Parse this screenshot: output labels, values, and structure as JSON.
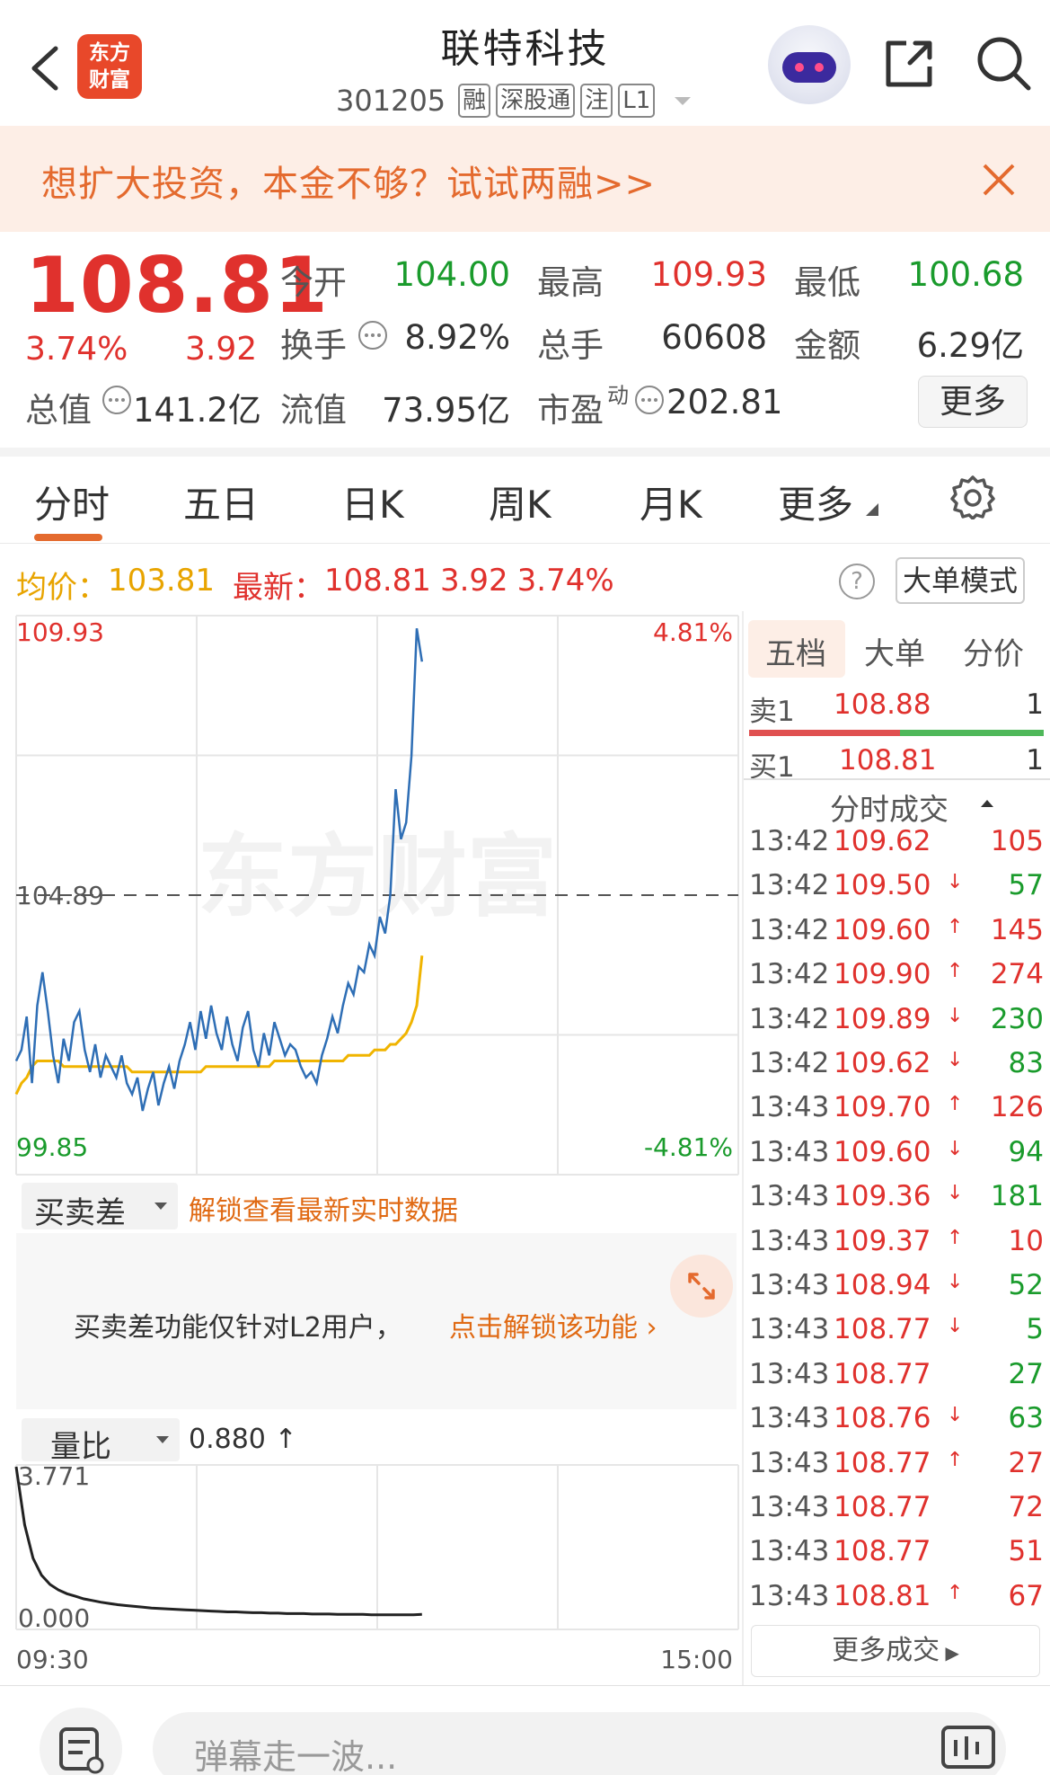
{
  "header": {
    "logo_line1": "东方",
    "logo_line2": "财富",
    "title": "联特科技",
    "code": "301205",
    "tags": [
      "融",
      "深股通",
      "注",
      "L1"
    ]
  },
  "banner": {
    "text": "想扩大投资，本金不够？试试两融>>"
  },
  "quote": {
    "price": "108.81",
    "change_pct": "3.74%",
    "change": "3.92",
    "fields": [
      {
        "label": "今开",
        "value": "104.00",
        "color": "green"
      },
      {
        "label": "最高",
        "value": "109.93",
        "color": "red"
      },
      {
        "label": "最低",
        "value": "100.68",
        "color": "green"
      },
      {
        "label": "换手",
        "value": "8.92%",
        "color": "dark"
      },
      {
        "label": "总手",
        "value": "60608",
        "color": "dark"
      },
      {
        "label": "金额",
        "value": "6.29亿",
        "color": "dark"
      },
      {
        "label": "总值",
        "value": "141.2亿",
        "color": "dark"
      },
      {
        "label": "流值",
        "value": "73.95亿",
        "color": "dark"
      },
      {
        "label": "市盈",
        "value": "202.81",
        "color": "dark"
      }
    ],
    "pe_sup": "动",
    "more_label": "更多"
  },
  "tabs": [
    "分时",
    "五日",
    "日K",
    "周K",
    "月K",
    "更多"
  ],
  "info_line": {
    "avg_label": "均价：",
    "avg_value": "103.81",
    "latest_label": "最新：",
    "latest_value": "108.81",
    "latest_change": "3.92",
    "latest_pct": "3.74%",
    "help": "?",
    "mode_button": "大单模式"
  },
  "chart_data": {
    "type": "line",
    "y_max": 109.93,
    "y_min": 99.85,
    "ref": 104.89,
    "pct_max": "4.81%",
    "pct_min": "-4.81%",
    "watermark": "东方财富",
    "labels": {
      "y_max": "109.93",
      "y_min": "99.85",
      "ref": "104.89"
    },
    "series": [
      {
        "values": [
          101.9,
          102.1,
          102.7,
          101.5,
          102.9,
          103.5,
          102.8,
          102.0,
          101.5,
          102.3,
          101.9,
          102.6,
          102.8,
          102.1,
          101.7,
          102.2,
          101.6,
          102.0,
          101.8,
          101.6,
          102.0,
          101.5,
          101.3,
          101.6,
          101.0,
          101.4,
          101.7,
          101.1,
          101.5,
          101.8,
          101.4,
          101.9,
          102.2,
          102.6,
          102.1,
          102.8,
          102.3,
          102.9,
          102.4,
          102.1,
          102.7,
          102.2,
          101.9,
          102.5,
          102.8,
          102.1,
          101.8,
          102.4,
          102.0,
          102.6,
          102.3,
          102.0,
          102.2,
          102.1,
          101.8,
          101.6,
          101.7,
          101.5,
          102.0,
          102.3,
          102.7,
          102.4,
          102.9,
          103.3,
          103.1,
          103.6,
          103.5,
          104.0,
          103.8,
          104.5,
          104.2,
          104.9,
          106.8,
          105.9,
          106.2,
          107.4,
          109.7,
          109.1
        ],
        "avg_values": [
          101.3,
          101.5,
          101.6,
          101.8,
          101.9,
          101.9,
          101.9,
          101.9,
          101.9,
          101.8,
          101.8,
          101.8,
          101.8,
          101.8,
          101.8,
          101.8,
          101.8,
          101.8,
          101.8,
          101.8,
          101.8,
          101.8,
          101.7,
          101.7,
          101.7,
          101.7,
          101.7,
          101.7,
          101.7,
          101.7,
          101.7,
          101.7,
          101.7,
          101.7,
          101.7,
          101.7,
          101.8,
          101.8,
          101.8,
          101.8,
          101.8,
          101.8,
          101.8,
          101.8,
          101.8,
          101.8,
          101.8,
          101.8,
          101.8,
          101.9,
          101.9,
          101.9,
          101.9,
          101.9,
          101.9,
          101.9,
          101.9,
          101.9,
          101.9,
          101.9,
          101.9,
          101.9,
          101.9,
          102.0,
          102.0,
          102.0,
          102.0,
          102.0,
          102.1,
          102.1,
          102.1,
          102.2,
          102.2,
          102.3,
          102.4,
          102.6,
          102.9,
          103.8
        ]
      }
    ],
    "volume_ratio": {
      "label": "量比",
      "current": "0.880",
      "arrow": "↑",
      "max_label": "3.771",
      "min_label": "0.000",
      "values": [
        3.77,
        2.4,
        1.6,
        1.2,
        0.98,
        0.85,
        0.76,
        0.7,
        0.64,
        0.6,
        0.56,
        0.53,
        0.5,
        0.48,
        0.46,
        0.44,
        0.42,
        0.41,
        0.4,
        0.39,
        0.38,
        0.37,
        0.36,
        0.35,
        0.34,
        0.33,
        0.33,
        0.32,
        0.31,
        0.31,
        0.3,
        0.3,
        0.29,
        0.29,
        0.29,
        0.28,
        0.28,
        0.28,
        0.27,
        0.27,
        0.27,
        0.27,
        0.26,
        0.26,
        0.26,
        0.26,
        0.26,
        0.26,
        0.27
      ]
    },
    "time_start": "09:30",
    "time_end": "15:00"
  },
  "buysell": {
    "selector_label": "买卖差",
    "unlock_link": "解锁查看最新实时数据",
    "message": "买卖差功能仅针对L2用户，",
    "message_link": "点击解锁该功能"
  },
  "right_panel": {
    "tabs": [
      "五档",
      "大单",
      "分价"
    ],
    "sell": {
      "label": "卖1",
      "price": "108.88",
      "volume": "1"
    },
    "buy": {
      "label": "买1",
      "price": "108.81",
      "volume": "1"
    },
    "trades_title": "分时成交",
    "trades": [
      {
        "time": "13:42",
        "price": "109.62",
        "arrow": "",
        "vol": "105",
        "pc": "red",
        "vc": "red"
      },
      {
        "time": "13:42",
        "price": "109.50",
        "arrow": "↓",
        "vol": "57",
        "pc": "red",
        "vc": "green"
      },
      {
        "time": "13:42",
        "price": "109.60",
        "arrow": "↑",
        "vol": "145",
        "pc": "red",
        "vc": "red"
      },
      {
        "time": "13:42",
        "price": "109.90",
        "arrow": "↑",
        "vol": "274",
        "pc": "red",
        "vc": "red"
      },
      {
        "time": "13:42",
        "price": "109.89",
        "arrow": "↓",
        "vol": "230",
        "pc": "red",
        "vc": "green"
      },
      {
        "time": "13:42",
        "price": "109.62",
        "arrow": "↓",
        "vol": "83",
        "pc": "red",
        "vc": "green"
      },
      {
        "time": "13:43",
        "price": "109.70",
        "arrow": "↑",
        "vol": "126",
        "pc": "red",
        "vc": "red"
      },
      {
        "time": "13:43",
        "price": "109.60",
        "arrow": "↓",
        "vol": "94",
        "pc": "red",
        "vc": "green"
      },
      {
        "time": "13:43",
        "price": "109.36",
        "arrow": "↓",
        "vol": "181",
        "pc": "red",
        "vc": "green"
      },
      {
        "time": "13:43",
        "price": "109.37",
        "arrow": "↑",
        "vol": "10",
        "pc": "red",
        "vc": "red"
      },
      {
        "time": "13:43",
        "price": "108.94",
        "arrow": "↓",
        "vol": "52",
        "pc": "red",
        "vc": "green"
      },
      {
        "time": "13:43",
        "price": "108.77",
        "arrow": "↓",
        "vol": "5",
        "pc": "red",
        "vc": "green"
      },
      {
        "time": "13:43",
        "price": "108.77",
        "arrow": "",
        "vol": "27",
        "pc": "red",
        "vc": "green"
      },
      {
        "time": "13:43",
        "price": "108.76",
        "arrow": "↓",
        "vol": "63",
        "pc": "red",
        "vc": "green"
      },
      {
        "time": "13:43",
        "price": "108.77",
        "arrow": "↑",
        "vol": "27",
        "pc": "red",
        "vc": "red"
      },
      {
        "time": "13:43",
        "price": "108.77",
        "arrow": "",
        "vol": "72",
        "pc": "red",
        "vc": "red"
      },
      {
        "time": "13:43",
        "price": "108.77",
        "arrow": "",
        "vol": "51",
        "pc": "red",
        "vc": "red"
      },
      {
        "time": "13:43",
        "price": "108.81",
        "arrow": "↑",
        "vol": "67",
        "pc": "red",
        "vc": "red"
      }
    ],
    "more_trades": "更多成交"
  },
  "bottom": {
    "placeholder": "弹幕走一波..."
  },
  "colors": {
    "red": "#e0312d",
    "green": "#1a9b2c",
    "orange": "#e06a14",
    "avg_line": "#f0b400",
    "price_line": "#2e6eb5"
  }
}
